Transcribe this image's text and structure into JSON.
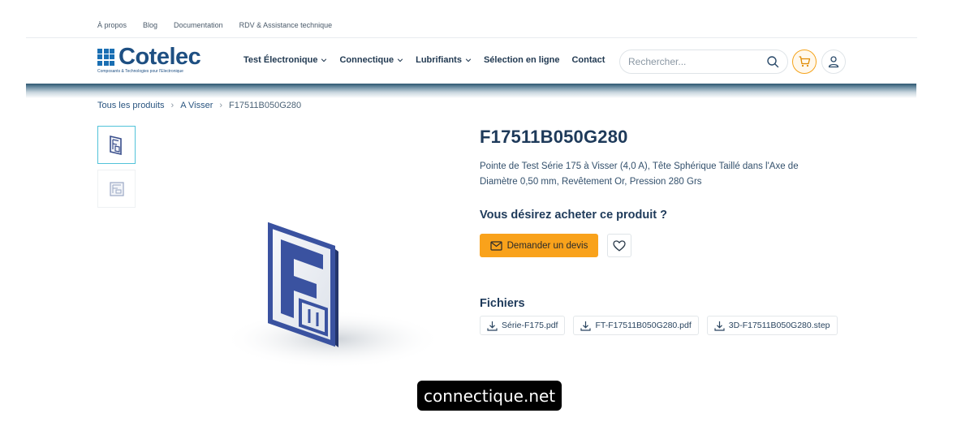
{
  "topbar": {
    "links": [
      "À propos",
      "Blog",
      "Documentation",
      "RDV & Assistance technique"
    ]
  },
  "logo": {
    "name": "Cotelec",
    "tagline": "Composants & Technologies pour l'Electronique"
  },
  "nav": {
    "items": [
      {
        "label": "Test Électronique",
        "dropdown": true
      },
      {
        "label": "Connectique",
        "dropdown": true
      },
      {
        "label": "Lubrifiants",
        "dropdown": true
      },
      {
        "label": "Sélection en ligne",
        "dropdown": false
      },
      {
        "label": "Contact",
        "dropdown": false
      }
    ]
  },
  "search": {
    "placeholder": "Rechercher..."
  },
  "breadcrumb": {
    "items": [
      "Tous les produits",
      "A Visser",
      "F17511B050G280"
    ]
  },
  "product": {
    "title": "F17511B050G280",
    "description": "Pointe de Test Série 175 à Visser (4,0 A), Tête Sphérique Taillé dans l'Axe de Diamètre 0,50 mm, Revêtement Or, Pression 280 Grs",
    "buy_heading": "Vous désirez acheter ce produit ?",
    "quote_label": "Demander un devis",
    "files_heading": "Fichiers",
    "files": [
      "Série-F175.pdf",
      "FT-F17511B050G280.pdf",
      "3D-F17511B050G280.step"
    ]
  },
  "watermark": "connectique.net",
  "colors": {
    "accent": "#f9a21b",
    "brand": "#1e4f82",
    "logo_grid": "#1a6fb3",
    "thumb_active_border": "#52c3d9"
  },
  "icons": {
    "search": "search-icon",
    "cart": "cart-icon",
    "user": "user-icon",
    "mail": "mail-icon",
    "heart": "heart-icon",
    "download": "download-icon",
    "chevron": "chevron-down-icon"
  }
}
